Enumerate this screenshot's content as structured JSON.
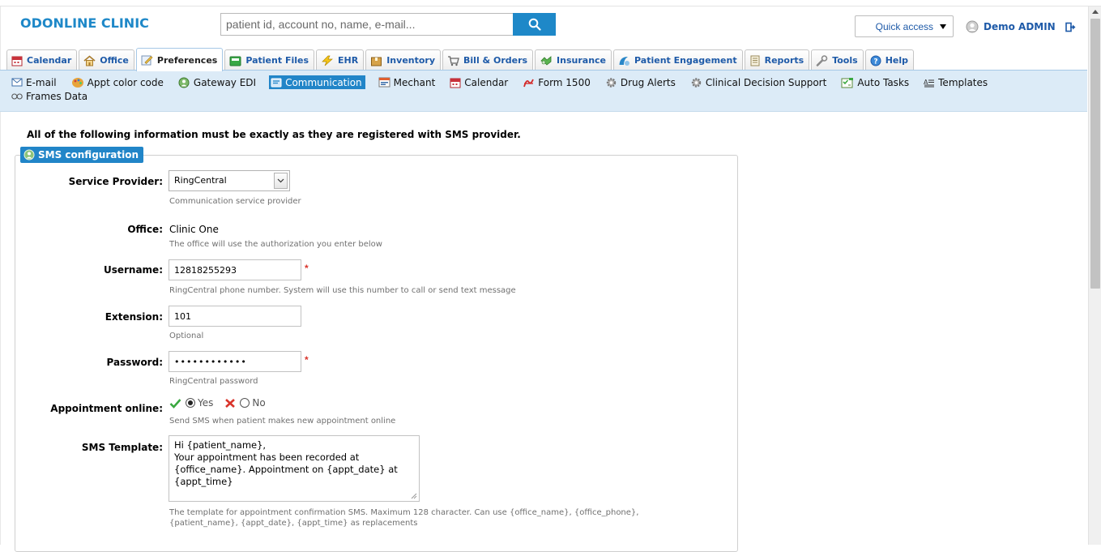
{
  "brand": {
    "name": "ODONLINE CLINIC",
    "accent": "#1e88c8"
  },
  "search": {
    "placeholder": "patient id, account no, name, e-mail..."
  },
  "header": {
    "quick_access": "Quick access",
    "user_name": "Demo ADMIN"
  },
  "tabs": [
    {
      "label": "Calendar",
      "icon": "calendar-icon"
    },
    {
      "label": "Office",
      "icon": "home-icon"
    },
    {
      "label": "Preferences",
      "icon": "preferences-icon",
      "active": true
    },
    {
      "label": "Patient Files",
      "icon": "folder-icon"
    },
    {
      "label": "EHR",
      "icon": "lightning-icon"
    },
    {
      "label": "Inventory",
      "icon": "box-icon"
    },
    {
      "label": "Bill & Orders",
      "icon": "cart-icon"
    },
    {
      "label": "Insurance",
      "icon": "shield-icon"
    },
    {
      "label": "Patient Engagement",
      "icon": "engagement-icon"
    },
    {
      "label": "Reports",
      "icon": "report-icon"
    },
    {
      "label": "Tools",
      "icon": "wrench-icon"
    },
    {
      "label": "Help",
      "icon": "help-icon"
    }
  ],
  "subnav": [
    {
      "label": "E-mail",
      "icon": "envelope-icon"
    },
    {
      "label": "Appt color code",
      "icon": "palette-icon"
    },
    {
      "label": "Gateway EDI",
      "icon": "gateway-icon"
    },
    {
      "label": "Communication",
      "icon": "communication-icon",
      "active": true
    },
    {
      "label": "Mechant",
      "icon": "merchant-icon"
    },
    {
      "label": "Calendar",
      "icon": "calendar-icon"
    },
    {
      "label": "Form 1500",
      "icon": "pdf-icon"
    },
    {
      "label": "Drug Alerts",
      "icon": "gear-icon"
    },
    {
      "label": "Clinical Decision Support",
      "icon": "gear-icon"
    },
    {
      "label": "Auto Tasks",
      "icon": "tasks-icon"
    },
    {
      "label": "Templates",
      "icon": "template-icon"
    },
    {
      "label": "Frames Data",
      "icon": "frames-icon"
    }
  ],
  "content": {
    "notice": "All of the following information must be exactly as they are registered with SMS provider.",
    "section_title": "SMS configuration",
    "service_provider": {
      "label": "Service Provider:",
      "value": "RingCentral",
      "hint": "Communication service provider"
    },
    "office": {
      "label": "Office:",
      "value": "Clinic One",
      "hint": "The office will use the authorization you enter below"
    },
    "username": {
      "label": "Username:",
      "value": "12818255293",
      "hint": "RingCentral phone number. System will use this number to call or send text message",
      "required": "*"
    },
    "extension": {
      "label": "Extension:",
      "value": "101",
      "hint": "Optional"
    },
    "password": {
      "label": "Password:",
      "value": "••••••••••••",
      "hint": "RingCentral password",
      "required": "*"
    },
    "appointment_online": {
      "label": "Appointment online:",
      "yes": "Yes",
      "no": "No",
      "selected": "Yes",
      "hint": "Send SMS when patient makes new appointment online"
    },
    "sms_template": {
      "label": "SMS Template:",
      "value": "Hi {patient_name},\nYour appointment has been recorded at\n{office_name}. Appointment on {appt_date} at\n{appt_time}",
      "hint_line1": "The template for appointment confirmation SMS. Maximum 128 character. Can use {office_name}, {office_phone},",
      "hint_line2": "{patient_name}, {appt_date}, {appt_time} as replacements"
    }
  }
}
